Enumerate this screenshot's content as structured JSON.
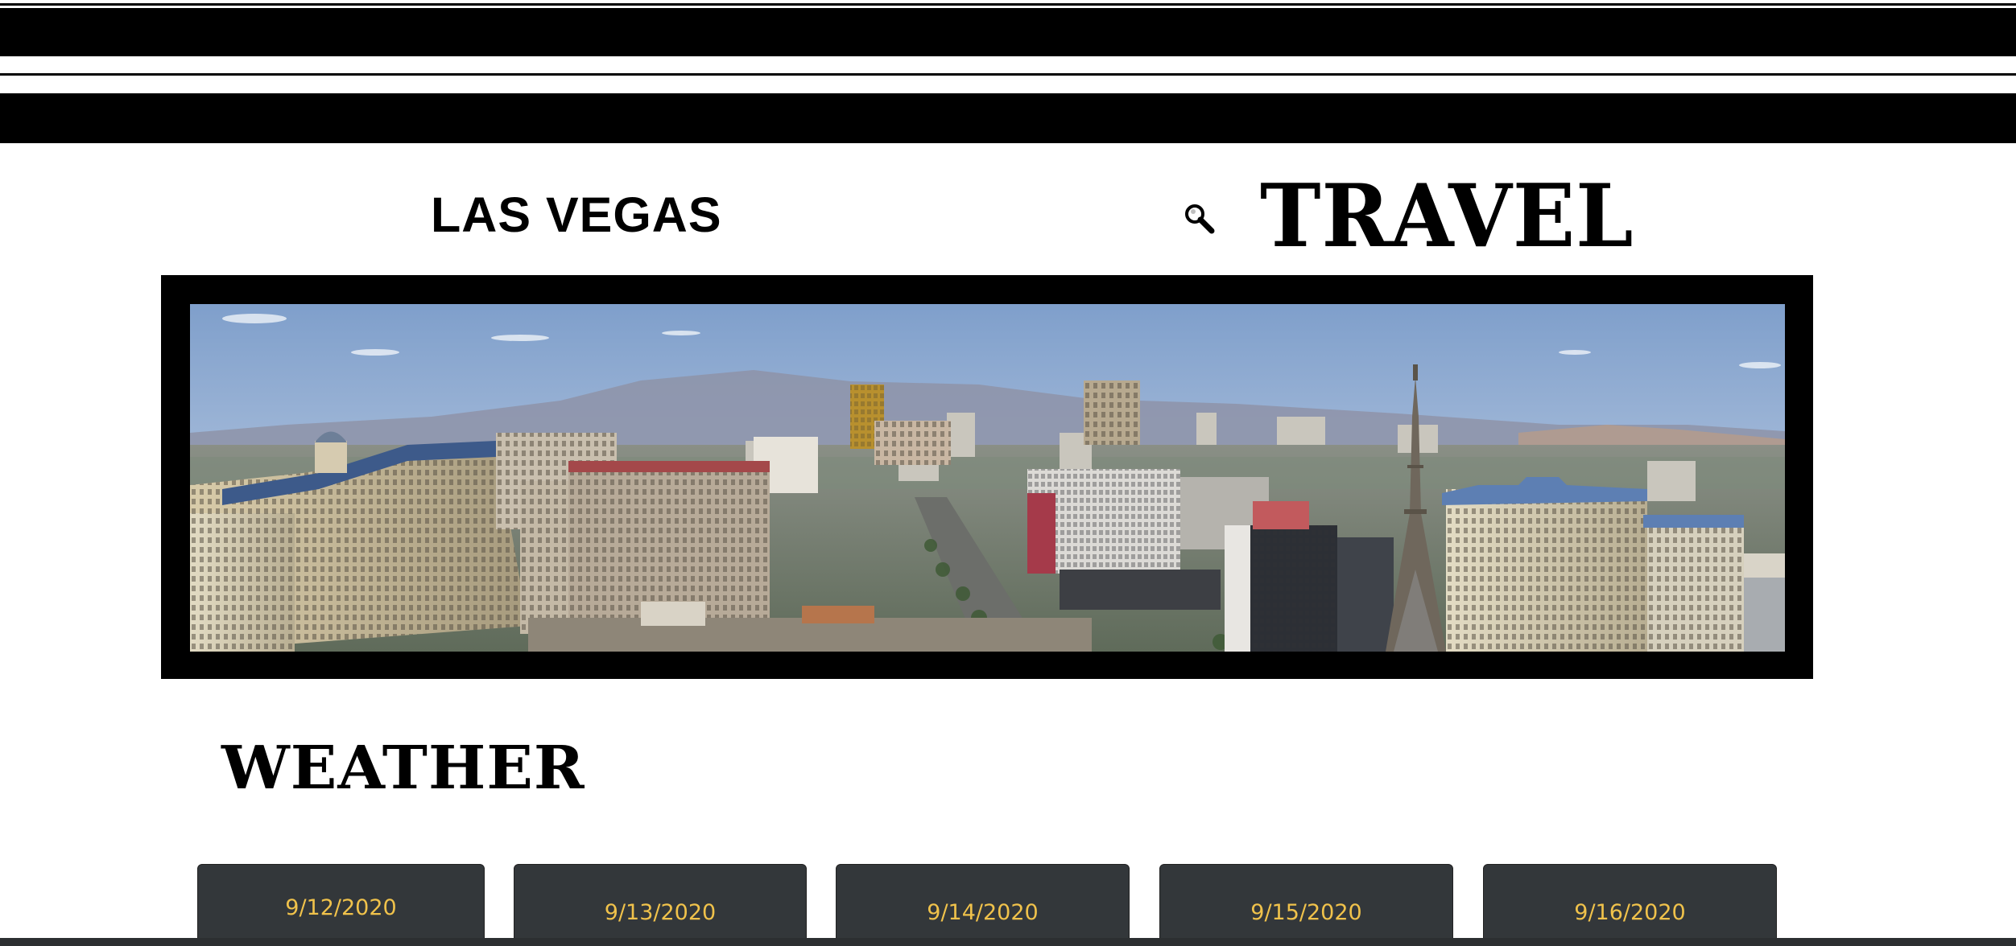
{
  "header": {
    "city_title": "LAS VEGAS",
    "brand_title": "TRAVEL",
    "search_icon": "magnifier-icon"
  },
  "hero": {
    "image": "las-vegas-strip-panorama"
  },
  "weather": {
    "section_title": "WEATHER",
    "cards": [
      {
        "date": "9/12/2020"
      },
      {
        "date": "9/13/2020"
      },
      {
        "date": "9/14/2020"
      },
      {
        "date": "9/15/2020"
      },
      {
        "date": "9/16/2020"
      }
    ]
  },
  "colors": {
    "card_bg": "#33373a",
    "date_text": "#f0c24b",
    "frame": "#000000"
  }
}
